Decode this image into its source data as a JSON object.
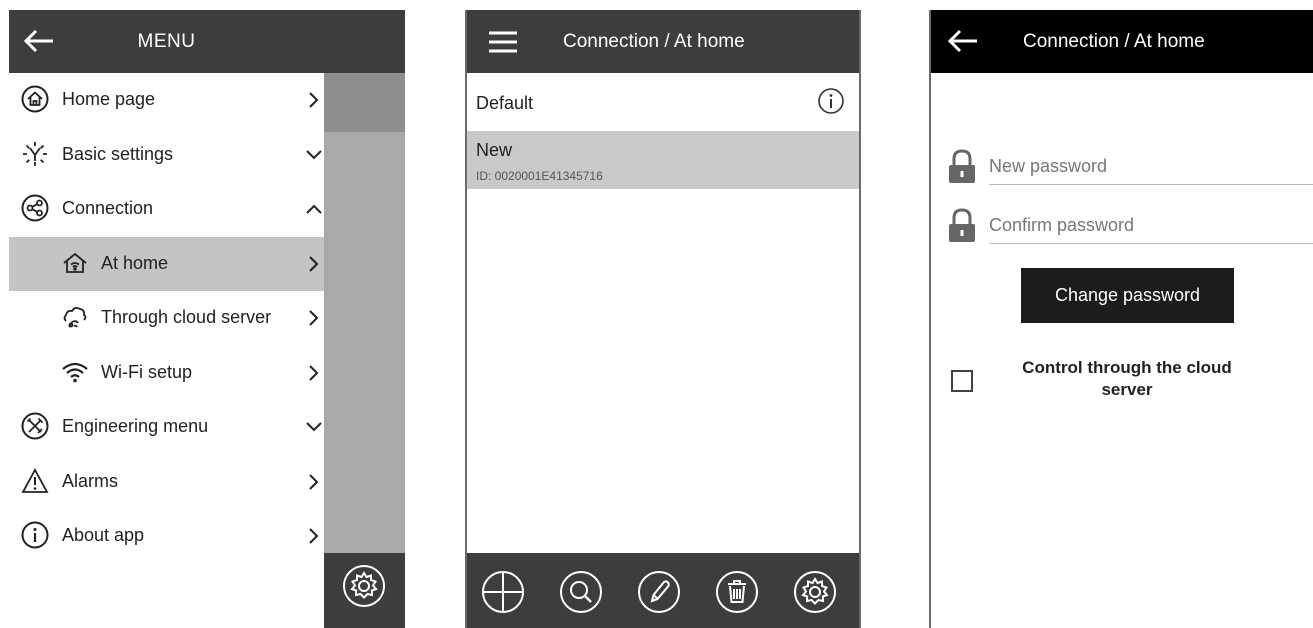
{
  "menu_screen": {
    "title": "MENU",
    "items": [
      {
        "label": "Home page",
        "icon": "home-icon",
        "arrow": "chevron-right-icon"
      },
      {
        "label": "Basic settings",
        "icon": "basic-settings-icon",
        "arrow": "chevron-down-icon"
      },
      {
        "label": "Connection",
        "icon": "share-icon",
        "arrow": "chevron-up-icon"
      },
      {
        "label": "At home",
        "icon": "house-icon",
        "arrow": "chevron-right-icon",
        "active": true
      },
      {
        "label": "Through cloud server",
        "icon": "cloud-server-icon",
        "arrow": "chevron-right-icon"
      },
      {
        "label": "Wi-Fi setup",
        "icon": "wifi-icon",
        "arrow": "chevron-right-icon"
      },
      {
        "label": "Engineering menu",
        "icon": "tools-icon",
        "arrow": "chevron-down-icon"
      },
      {
        "label": "Alarms",
        "icon": "warning-icon",
        "arrow": "chevron-right-icon"
      },
      {
        "label": "About app",
        "icon": "info-icon",
        "arrow": "chevron-right-icon"
      }
    ]
  },
  "list_screen": {
    "title": "Connection / At home",
    "rows": [
      {
        "label": "Default"
      },
      {
        "label": "New",
        "id": "ID: 0020001E41345716"
      }
    ],
    "toolbar": [
      "add-icon",
      "search-icon",
      "edit-icon",
      "delete-icon",
      "settings-icon"
    ]
  },
  "password_screen": {
    "title": "Connection / At home",
    "new_password_placeholder": "New password",
    "confirm_password_placeholder": "Confirm password",
    "change_button": "Change password",
    "cloud_checkbox_label": "Control through the cloud server",
    "cloud_checkbox_checked": false
  },
  "colors": {
    "header_dark": "#3d3d3d",
    "header_black": "#000000",
    "active_row": "#c4c4c4",
    "overlay": "#a9a9a9"
  }
}
